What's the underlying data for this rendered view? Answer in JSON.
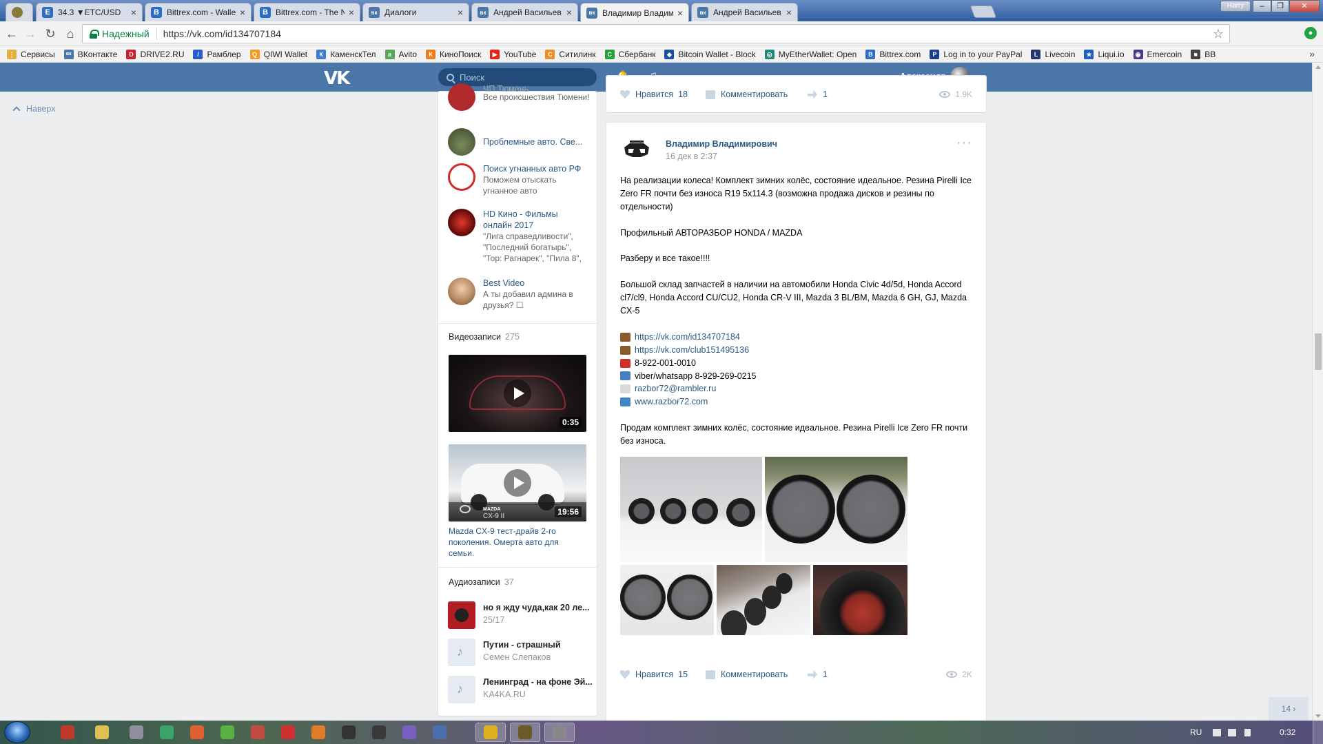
{
  "browser": {
    "tabs": [
      {
        "title": "",
        "favicon_color": "#8a7a3a",
        "favicon_char": ""
      },
      {
        "title": "34.3 ▼ETC/USD",
        "favicon_color": "#2e6fc2",
        "favicon_char": "E"
      },
      {
        "title": "Bittrex.com - Wallets",
        "favicon_color": "#2b6cc4",
        "favicon_char": "B"
      },
      {
        "title": "Bittrex.com - The Next G",
        "favicon_color": "#2b6cc4",
        "favicon_char": "B"
      },
      {
        "title": "Диалоги",
        "favicon_color": "#4a76a8",
        "favicon_char": "вк"
      },
      {
        "title": "Андрей Васильев",
        "favicon_color": "#4a76a8",
        "favicon_char": "вк"
      },
      {
        "title": "Владимир Владимиров",
        "favicon_color": "#4a76a8",
        "favicon_char": "вк"
      },
      {
        "title": "Андрей Васильев",
        "favicon_color": "#4a76a8",
        "favicon_char": "вк"
      }
    ],
    "close_glyph": "×",
    "window_user": "Harry",
    "window_buttons": [
      "–",
      "❐",
      "✕"
    ],
    "nav": {
      "back": "←",
      "forward": "→",
      "reload": "↻",
      "home": "⌂"
    },
    "address": {
      "secure_label": "Надежный",
      "url": "https://vk.com/id134707184",
      "star": "☆"
    },
    "extension_icon": "●",
    "bookmarks": [
      {
        "label": "Сервисы",
        "color": "#e0b040",
        "char": "⋮"
      },
      {
        "label": "ВКонтакте",
        "color": "#4a76a8",
        "char": "вк"
      },
      {
        "label": "DRIVE2.RU",
        "color": "#c8202b",
        "char": "D"
      },
      {
        "label": "Рамблер",
        "color": "#2b5cc9",
        "char": "/"
      },
      {
        "label": "QIWI Wallet",
        "color": "#f59a1c",
        "char": "Q"
      },
      {
        "label": "КаменскТел",
        "color": "#3d7bcf",
        "char": "К"
      },
      {
        "label": "Avito",
        "color": "#58a65c",
        "char": "a"
      },
      {
        "label": "КиноПоиск",
        "color": "#f07b1c",
        "char": "К"
      },
      {
        "label": "YouTube",
        "color": "#e62117",
        "char": "▶"
      },
      {
        "label": "Ситилинк",
        "color": "#f08a24",
        "char": "С"
      },
      {
        "label": "Сбербанк",
        "color": "#21a038",
        "char": "С"
      },
      {
        "label": "Bitcoin Wallet - Block",
        "color": "#1a4fa3",
        "char": "◆"
      },
      {
        "label": "MyEtherWallet: Open",
        "color": "#1c8a7a",
        "char": "◎"
      },
      {
        "label": "Bittrex.com",
        "color": "#2b6cc4",
        "char": "B"
      },
      {
        "label": "Log in to your PayPal",
        "color": "#1a3d8f",
        "char": "P"
      },
      {
        "label": "Livecoin",
        "color": "#24376b",
        "char": "L"
      },
      {
        "label": "Liqui.io",
        "color": "#1f5fbd",
        "char": "★"
      },
      {
        "label": "Emercoin",
        "color": "#4a3a8a",
        "char": "◉"
      },
      {
        "label": "BB",
        "color": "#444444",
        "char": "■"
      }
    ],
    "bookmarks_more": "»"
  },
  "vk": {
    "logo": "VK",
    "search_placeholder": "Поиск",
    "bell": "🔔",
    "music": "♫",
    "user": "Александр",
    "chevron": "⌄",
    "to_top": "Наверх",
    "groups": [
      {
        "name": "ЧП Тюмень",
        "desc": "Все происшествия Тюмени!",
        "color": "#b0292b"
      },
      {
        "name": "Проблемные авто. Све...",
        "desc": "",
        "color": "#5b6a4a"
      },
      {
        "name": "Поиск угнанных авто РФ",
        "desc": "Поможем отыскать угнанное авто",
        "color": "#d02a2a"
      },
      {
        "name": "HD Кино - Фильмы онлайн 2017",
        "desc": "\"Лига справедливости\", \"Последний богатырь\", \"Тор: Рагнарек\", \"Пила 8\",",
        "color": "#8a1010"
      },
      {
        "name": "Best Video",
        "desc": "А ты добавил админа в друзья? ☐",
        "color": "#c89a70"
      }
    ],
    "videos": {
      "title": "Видеозаписи",
      "count": "275",
      "items": [
        {
          "duration": "0:35"
        },
        {
          "duration": "19:56",
          "badge_brand": "MAZDA",
          "badge_model": "CX-9 II"
        }
      ],
      "caption": "Mazda CX-9 тест-драйв 2-го поколения. Омерта авто для семьи."
    },
    "audios": {
      "title": "Аудиозаписи",
      "count": "37",
      "items": [
        {
          "title": "но я жду чуда,как 20 ле...",
          "artist": "25/17"
        },
        {
          "title": "Путин - страшный",
          "artist": "Семен Слепаков"
        },
        {
          "title": "Ленинград - на фоне Эй...",
          "artist": "KA4KA.RU"
        }
      ],
      "note_glyph": "♪"
    },
    "prev_post": {
      "like_label": "Нравится",
      "likes": "18",
      "comment_label": "Комментировать",
      "shares": "1",
      "views": "1.9K"
    },
    "post": {
      "author": "Владимир Владимирович",
      "date": "16 дек в 2:37",
      "menu": "···",
      "p1": "На реализации колеса! Комплект зимних колёс, состояние идеальное. Резина Pirelli Ice Zero FR почти без износа R19 5x114.3 (возможна продажа дисков и резины по отдельности)",
      "p2": "Профильный АВТОРАЗБОР HONDA / MAZDA",
      "p3": "Разберу и все такое!!!!",
      "p4": "Большой склад запчастей в наличии на автомобили Honda Civic 4d/5d, Honda Accord cl7/cl9, Honda Accord CU/CU2, Honda CR-V III, Mazda 3 BL/BM, Mazda 6 GH, GJ, Mazda CX-5",
      "contacts": [
        {
          "text": "https://vk.com/id134707184",
          "link": true,
          "emoji_color": "#8b5a2b"
        },
        {
          "text": "https://vk.com/club151495136",
          "link": true,
          "emoji_color": "#8b5a2b"
        },
        {
          "text": "8-922-001-0010",
          "link": false,
          "emoji_color": "#d0302a"
        },
        {
          "text": "viber/whatsapp 8-929-269-0215",
          "link": false,
          "emoji_color": "#4a7ec2"
        },
        {
          "text": "razbor72@rambler.ru",
          "link": true,
          "emoji_color": "#d9d9d9"
        },
        {
          "text": "www.razbor72.com",
          "link": true,
          "emoji_color": "#3f86c9"
        }
      ],
      "p5": "Продам комплект зимних колёс, состояние идеальное. Резина Pirelli Ice Zero FR почти без износа.",
      "like_label": "Нравится",
      "likes": "15",
      "comment_label": "Комментировать",
      "shares": "1",
      "views": "2K"
    },
    "message_counter": "14 ›"
  },
  "taskbar": {
    "language": "RU",
    "clock": "0:32",
    "apps": [
      {
        "color": "#c0392b"
      },
      {
        "color": "#e0c050"
      },
      {
        "color": "#8e8e9e"
      },
      {
        "color": "#3aa36a"
      },
      {
        "color": "#e06030"
      },
      {
        "color": "#5bb043"
      },
      {
        "color": "#c44a44"
      },
      {
        "color": "#d03030"
      },
      {
        "color": "#e07b2a"
      },
      {
        "color": "#333333"
      },
      {
        "color": "#3a3a3a"
      },
      {
        "color": "#7a5fc0"
      },
      {
        "color": "#4a6fb0"
      },
      {
        "color": "#e0b020"
      },
      {
        "color": "#6a5a2a"
      },
      {
        "color": "#888888"
      }
    ]
  }
}
